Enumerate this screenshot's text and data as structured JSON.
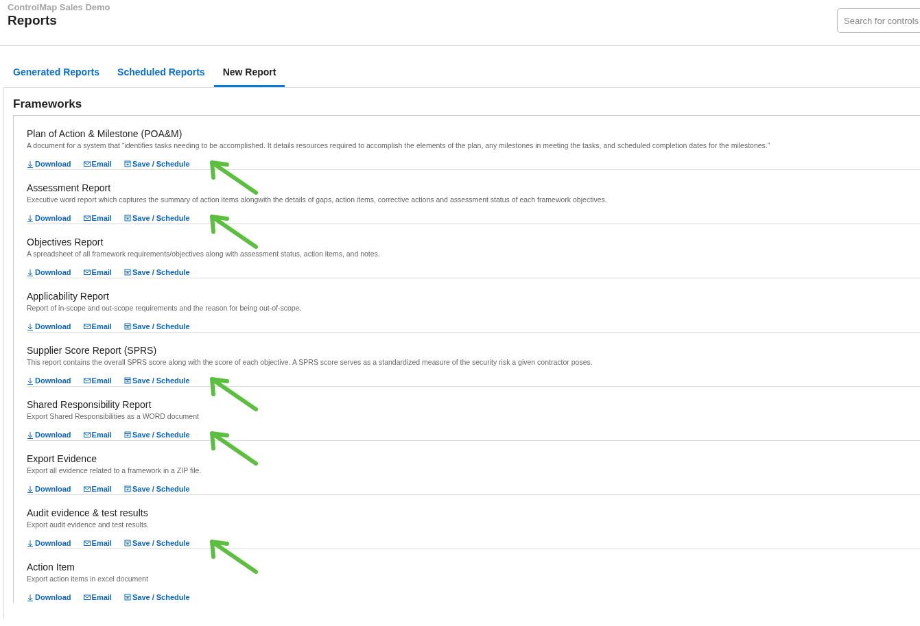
{
  "header": {
    "subtitle": "ControlMap Sales Demo",
    "title": "Reports",
    "search": {
      "placeholder": "Search for controls"
    }
  },
  "tabs": [
    {
      "label": "Generated Reports",
      "selected": false
    },
    {
      "label": "Scheduled Reports",
      "selected": false
    },
    {
      "label": "New Report",
      "selected": true
    }
  ],
  "section": {
    "title": "Frameworks"
  },
  "reports": [
    {
      "title": "Plan of Action & Milestone (POA&M)",
      "description": "A document for a system that “identifies tasks needing to be accomplished. It details resources required to accomplish the elements of the plan, any milestones in meeting the tasks, and scheduled completion dates for the milestones.”",
      "actions": [
        "Download",
        "Email",
        "Save / Schedule"
      ],
      "annotated": true
    },
    {
      "title": "Assessment Report",
      "description": "Executive word report which captures the summary of action items alongwith the details of gaps, action items, corrective actions and assessment status of each framework objectives.",
      "actions": [
        "Download",
        "Email",
        "Save / Schedule"
      ],
      "annotated": true
    },
    {
      "title": "Objectives Report",
      "description": "A spreadsheet of all framework requirements/objectives along with assessment status, action items, and notes.",
      "actions": [
        "Download",
        "Email",
        "Save / Schedule"
      ],
      "annotated": false
    },
    {
      "title": "Applicability Report",
      "description": "Report of in-scope and out-scope requirements and the reason for being out-of-scope.",
      "actions": [
        "Download",
        "Email",
        "Save / Schedule"
      ],
      "annotated": false
    },
    {
      "title": "Supplier Score Report (SPRS)",
      "description": "This report contains the overall SPRS score along with the score of each objective. A SPRS score serves as a standardized measure of the security risk a given contractor poses.",
      "actions": [
        "Download",
        "Email",
        "Save / Schedule"
      ],
      "annotated": true
    },
    {
      "title": "Shared Responsibility Report",
      "description": "Export Shared Responsibilities as a WORD document",
      "actions": [
        "Download",
        "Email",
        "Save / Schedule"
      ],
      "annotated": true
    },
    {
      "title": "Export Evidence",
      "description": "Export all evidence related to a framework in a ZIP file.",
      "actions": [
        "Download",
        "Email",
        "Save / Schedule"
      ],
      "annotated": false
    },
    {
      "title": "Audit evidence & test results",
      "description": "Export audit evidence and test results.",
      "actions": [
        "Download",
        "Email",
        "Save / Schedule"
      ],
      "annotated": true
    },
    {
      "title": "Action Item",
      "description": "Export action items in excel document",
      "actions": [
        "Download",
        "Email",
        "Save / Schedule"
      ],
      "annotated": false
    }
  ]
}
